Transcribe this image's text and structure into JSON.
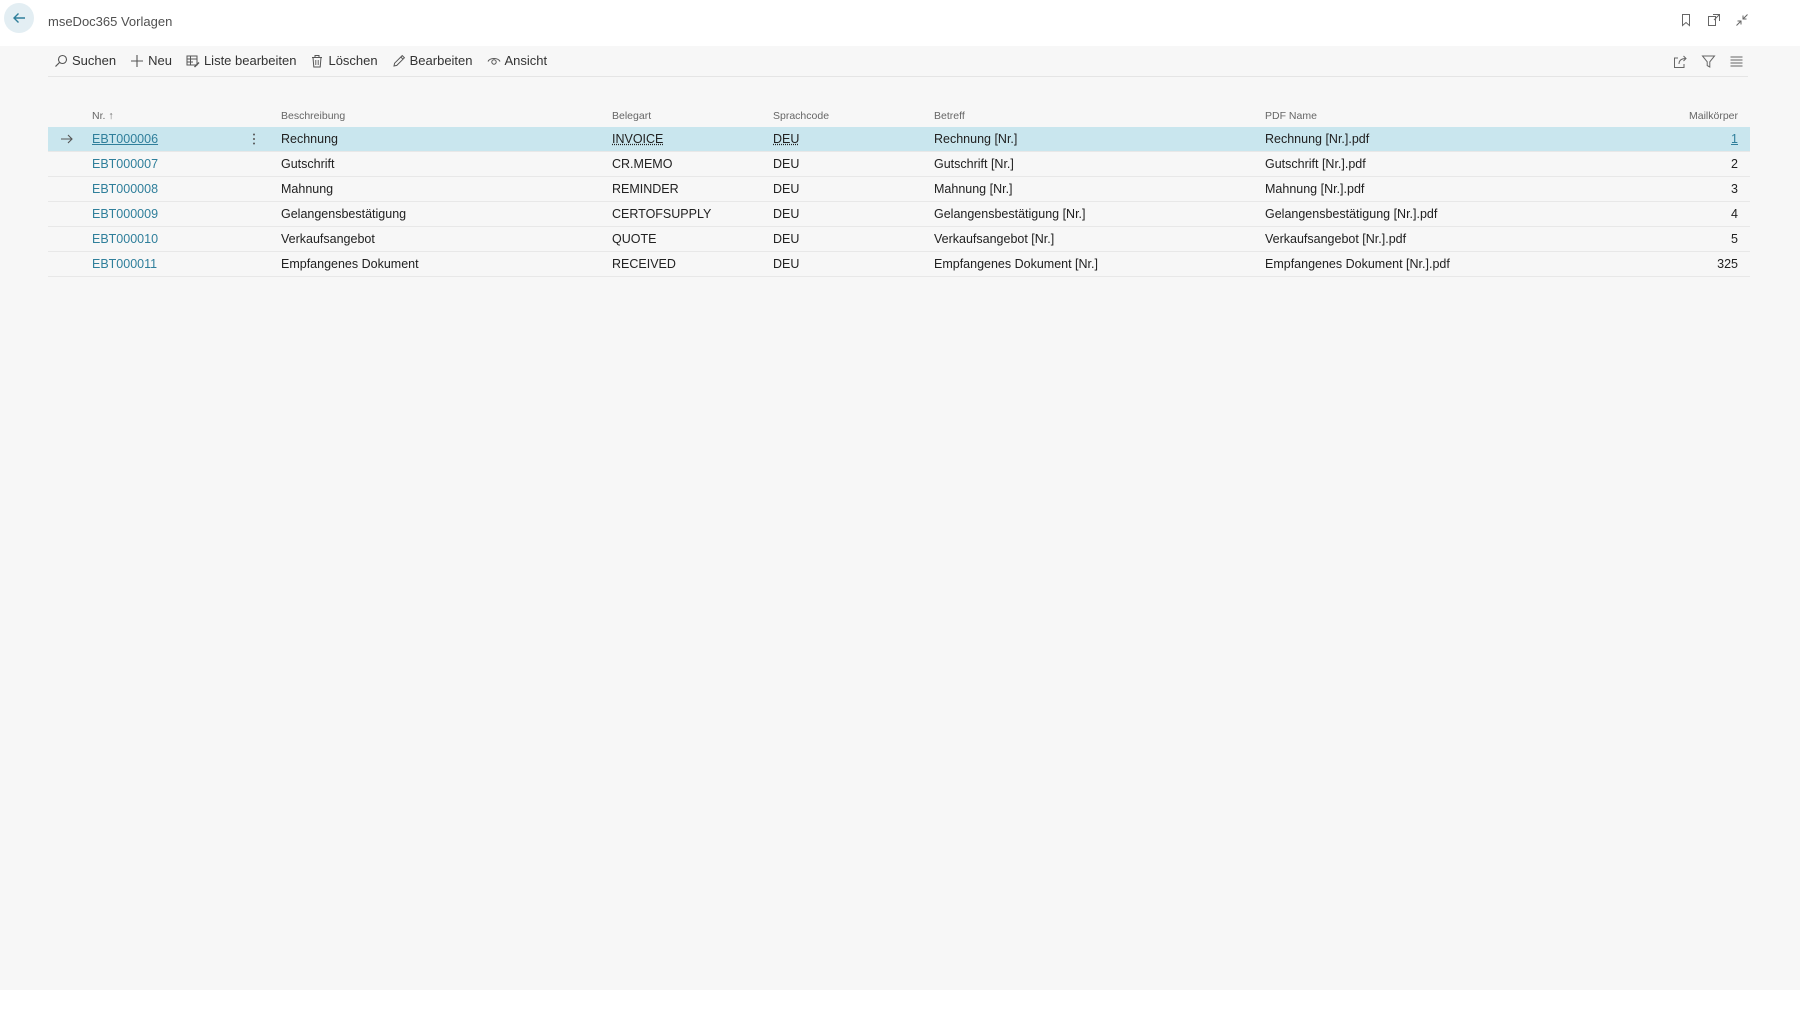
{
  "header": {
    "title": "mseDoc365 Vorlagen"
  },
  "toolbar": {
    "search_label": "Suchen",
    "new_label": "Neu",
    "edit_list_label": "Liste bearbeiten",
    "delete_label": "Löschen",
    "edit_label": "Bearbeiten",
    "view_label": "Ansicht"
  },
  "table": {
    "columns": {
      "nr": "Nr.",
      "beschreibung": "Beschreibung",
      "belegart": "Belegart",
      "sprachcode": "Sprachcode",
      "betreff": "Betreff",
      "pdf_name": "PDF Name",
      "mailkoerper": "Mailkörper"
    },
    "sort_indicator": "↑",
    "rows": [
      {
        "nr": "EBT000006",
        "beschreibung": "Rechnung",
        "belegart": "INVOICE",
        "sprachcode": "DEU",
        "betreff": "Rechnung [Nr.]",
        "pdf_name": "Rechnung [Nr.].pdf",
        "mailkoerper": "1"
      },
      {
        "nr": "EBT000007",
        "beschreibung": "Gutschrift",
        "belegart": "CR.MEMO",
        "sprachcode": "DEU",
        "betreff": "Gutschrift [Nr.]",
        "pdf_name": "Gutschrift [Nr.].pdf",
        "mailkoerper": "2"
      },
      {
        "nr": "EBT000008",
        "beschreibung": "Mahnung",
        "belegart": "REMINDER",
        "sprachcode": "DEU",
        "betreff": "Mahnung [Nr.]",
        "pdf_name": "Mahnung [Nr.].pdf",
        "mailkoerper": "3"
      },
      {
        "nr": "EBT000009",
        "beschreibung": "Gelangensbestätigung",
        "belegart": "CERTOFSUPPLY",
        "sprachcode": "DEU",
        "betreff": "Gelangensbestätigung [Nr.]",
        "pdf_name": "Gelangensbestätigung [Nr.].pdf",
        "mailkoerper": "4"
      },
      {
        "nr": "EBT000010",
        "beschreibung": "Verkaufsangebot",
        "belegart": "QUOTE",
        "sprachcode": "DEU",
        "betreff": "Verkaufsangebot [Nr.]",
        "pdf_name": "Verkaufsangebot [Nr.].pdf",
        "mailkoerper": "5"
      },
      {
        "nr": "EBT000011",
        "beschreibung": "Empfangenes Dokument",
        "belegart": "RECEIVED",
        "sprachcode": "DEU",
        "betreff": "Empfangenes Dokument [Nr.]",
        "pdf_name": "Empfangenes Dokument [Nr.].pdf",
        "mailkoerper": "325"
      }
    ]
  },
  "colors": {
    "accent": "#2f7f9b",
    "selected_row": "#c9e6ee",
    "background": "#f7f7f7"
  },
  "icons": {
    "back": "arrow-left-icon",
    "bookmark": "bookmark-icon",
    "open_new": "open-in-new-window-icon",
    "collapse": "collapse-icon",
    "search": "search-icon",
    "new": "plus-icon",
    "edit_list": "edit-list-icon",
    "delete": "trash-icon",
    "edit": "pencil-icon",
    "view": "eye-icon",
    "share": "share-icon",
    "filter": "filter-icon",
    "list_view": "list-view-icon",
    "row_arrow": "arrow-right-icon",
    "row_menu": "more-vertical-icon"
  }
}
